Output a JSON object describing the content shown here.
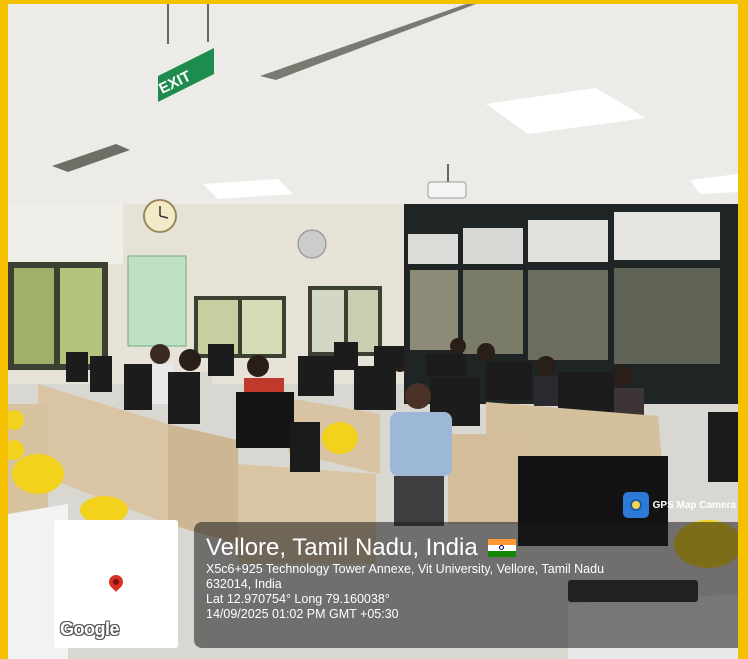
{
  "signage": {
    "exit": "EXIT"
  },
  "watermark": {
    "app_name": "GPS Map Camera",
    "map_attribution": "Google",
    "location_title": "Vellore, Tamil Nadu, India",
    "address_line1": "X5c6+925 Technology Tower Annexe, Vit University, Vellore, Tamil Nadu",
    "address_line2": "632014, India",
    "coordinates": "Lat 12.970754° Long 79.160038°",
    "timestamp": "14/09/2025 01:02 PM GMT +05:30"
  },
  "colors": {
    "border": "#f5c000",
    "map_pin": "#d93025",
    "flag_saffron": "#ff9933",
    "flag_green": "#138808"
  },
  "icons": [
    "map-pin-icon",
    "india-flag-icon",
    "gps-map-camera-app-icon"
  ]
}
